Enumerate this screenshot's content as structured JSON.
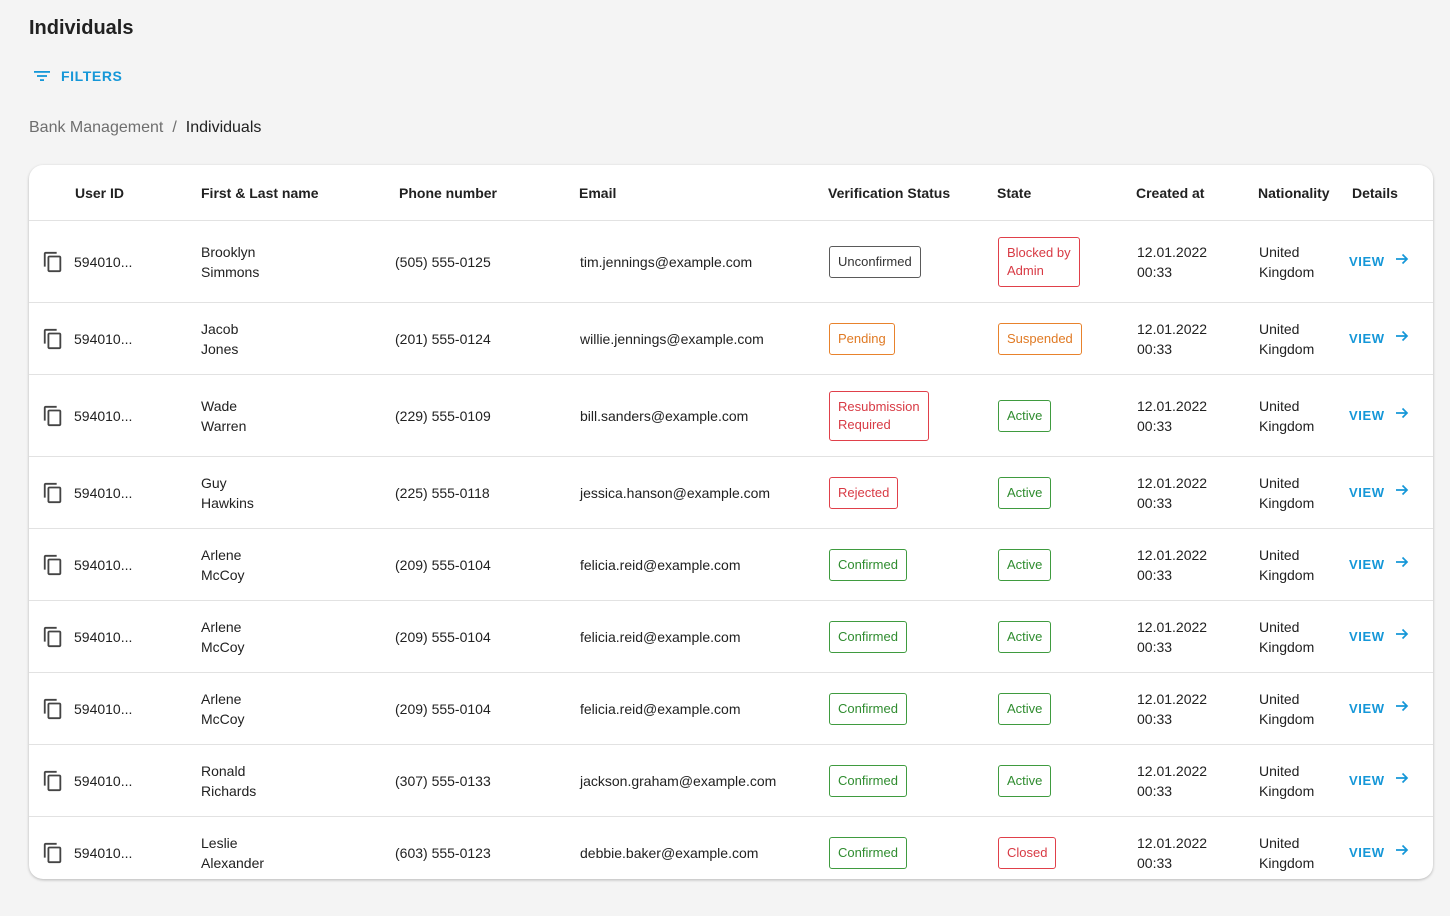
{
  "page": {
    "title": "Individuals"
  },
  "filters": {
    "label": "FILTERS",
    "icon": "filter-list-icon"
  },
  "breadcrumb": {
    "parent": "Bank Management",
    "separator": "/",
    "current": "Individuals"
  },
  "table": {
    "headers": {
      "user_id": "User ID",
      "name": "First & Last name",
      "phone": "Phone number",
      "email": "Email",
      "verification": "Verification Status",
      "state": "State",
      "created": "Created at",
      "nationality": "Nationality",
      "details": "Details"
    },
    "view_label": "VIEW",
    "rows": [
      {
        "user_id": "594010...",
        "name": "Brooklyn\nSimmons",
        "phone": "(505) 555-0125",
        "email": "tim.jennings@example.com",
        "verification": "Unconfirmed",
        "verification_kind": "neutral",
        "state": "Blocked by\nAdmin",
        "state_kind": "error",
        "created": "12.01.2022\n00:33",
        "nationality": "United\nKingdom"
      },
      {
        "user_id": "594010...",
        "name": "Jacob\nJones",
        "phone": "(201) 555-0124",
        "email": "willie.jennings@example.com",
        "verification": "Pending",
        "verification_kind": "warning",
        "state": "Suspended",
        "state_kind": "warning",
        "created": "12.01.2022\n00:33",
        "nationality": "United\nKingdom"
      },
      {
        "user_id": "594010...",
        "name": "Wade\nWarren",
        "phone": "(229) 555-0109",
        "email": "bill.sanders@example.com",
        "verification": "Resubmission\nRequired",
        "verification_kind": "error",
        "state": "Active",
        "state_kind": "success",
        "created": "12.01.2022\n00:33",
        "nationality": "United\nKingdom"
      },
      {
        "user_id": "594010...",
        "name": "Guy\nHawkins",
        "phone": "(225) 555-0118",
        "email": "jessica.hanson@example.com",
        "verification": "Rejected",
        "verification_kind": "error",
        "state": "Active",
        "state_kind": "success",
        "created": "12.01.2022\n00:33",
        "nationality": "United\nKingdom"
      },
      {
        "user_id": "594010...",
        "name": "Arlene\nMcCoy",
        "phone": "(209) 555-0104",
        "email": "felicia.reid@example.com",
        "verification": "Confirmed",
        "verification_kind": "success",
        "state": "Active",
        "state_kind": "success",
        "created": "12.01.2022\n00:33",
        "nationality": "United\nKingdom"
      },
      {
        "user_id": "594010...",
        "name": "Arlene\nMcCoy",
        "phone": "(209) 555-0104",
        "email": "felicia.reid@example.com",
        "verification": "Confirmed",
        "verification_kind": "success",
        "state": "Active",
        "state_kind": "success",
        "created": "12.01.2022\n00:33",
        "nationality": "United\nKingdom"
      },
      {
        "user_id": "594010...",
        "name": "Arlene\nMcCoy",
        "phone": "(209) 555-0104",
        "email": "felicia.reid@example.com",
        "verification": "Confirmed",
        "verification_kind": "success",
        "state": "Active",
        "state_kind": "success",
        "created": "12.01.2022\n00:33",
        "nationality": "United\nKingdom"
      },
      {
        "user_id": "594010...",
        "name": "Ronald\nRichards",
        "phone": "(307) 555-0133",
        "email": "jackson.graham@example.com",
        "verification": "Confirmed",
        "verification_kind": "success",
        "state": "Active",
        "state_kind": "success",
        "created": "12.01.2022\n00:33",
        "nationality": "United\nKingdom"
      },
      {
        "user_id": "594010...",
        "name": "Leslie\nAlexander",
        "phone": "(603) 555-0123",
        "email": "debbie.baker@example.com",
        "verification": "Confirmed",
        "verification_kind": "success",
        "state": "Closed",
        "state_kind": "error",
        "created": "12.01.2022\n00:33",
        "nationality": "United\nKingdom"
      }
    ]
  },
  "colors": {
    "accent": "#1597d8",
    "success": "#2f8c2f",
    "warning": "#e07a24",
    "error": "#d83a44",
    "neutral": "#333333"
  }
}
